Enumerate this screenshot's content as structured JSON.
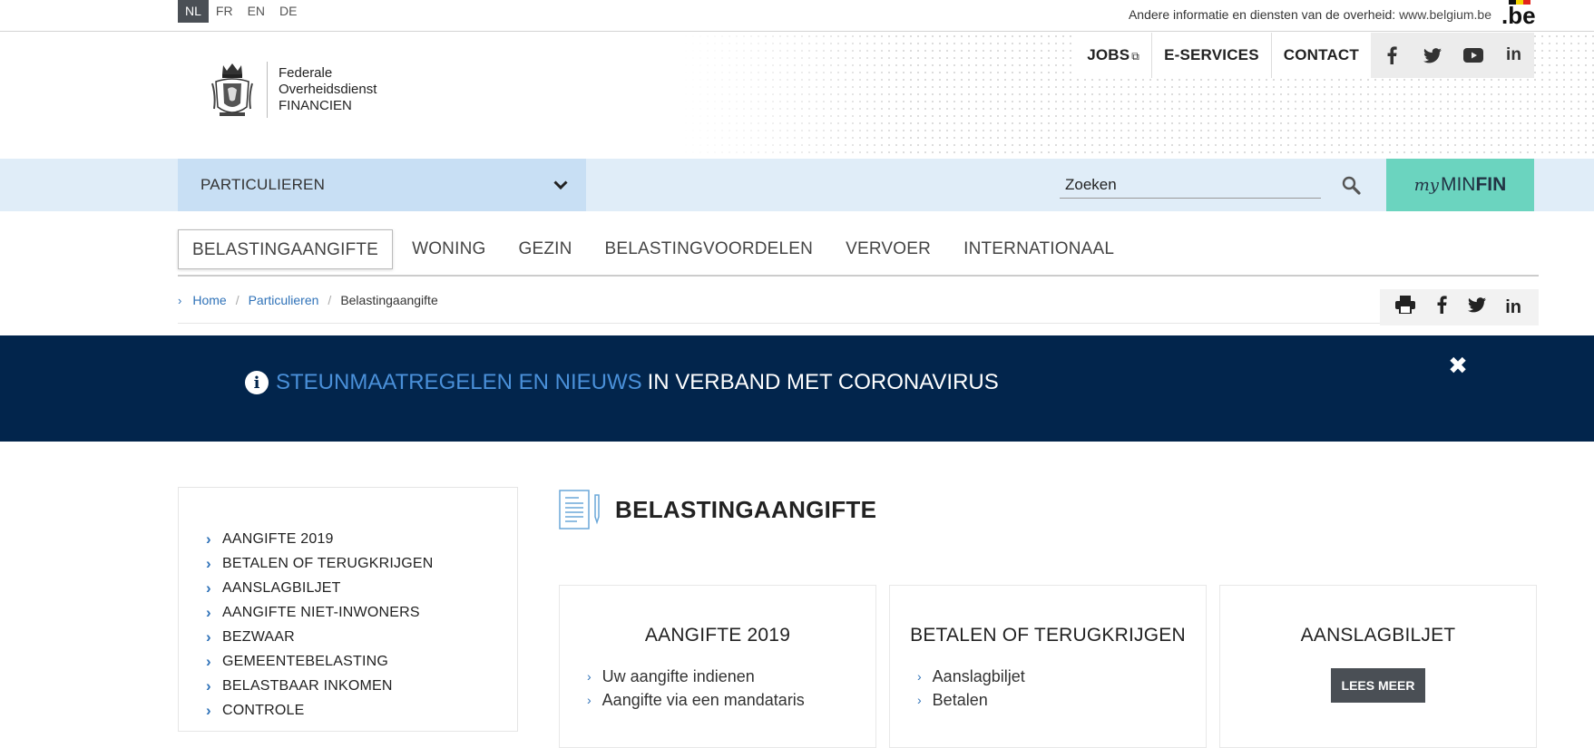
{
  "languages": [
    {
      "code": "NL",
      "active": true
    },
    {
      "code": "FR",
      "active": false
    },
    {
      "code": "EN",
      "active": false
    },
    {
      "code": "DE",
      "active": false
    }
  ],
  "gov_bar": {
    "text": "Andere informatie en diensten van de overheid:",
    "link": "www.belgium.be",
    "logo_text": ".be"
  },
  "logo": {
    "line1": "Federale",
    "line2": "Overheidsdienst",
    "line3": "FINANCIEN"
  },
  "topnav": {
    "jobs": "JOBS",
    "eservices": "E-SERVICES",
    "contact": "CONTACT"
  },
  "social": {
    "facebook": "f",
    "twitter": "twitter-icon",
    "youtube": "youtube-icon",
    "linkedin": "in"
  },
  "section_select": {
    "label": "PARTICULIEREN"
  },
  "search": {
    "placeholder": "Zoeken"
  },
  "myminfin": {
    "my": "my",
    "min": "MIN",
    "fin": "FIN"
  },
  "mainnav": {
    "items": [
      "BELASTINGAANGIFTE",
      "WONING",
      "GEZIN",
      "BELASTINGVOORDELEN",
      "VERVOER",
      "INTERNATIONAAL"
    ]
  },
  "breadcrumb": {
    "home": "Home",
    "particulieren": "Particulieren",
    "current": "Belastingaangifte"
  },
  "banner": {
    "link": "STEUNMAATREGELEN EN NIEUWS",
    "rest": "IN VERBAND MET CORONAVIRUS",
    "close": "✖"
  },
  "sidebar": {
    "items": [
      "AANGIFTE 2019",
      "BETALEN OF TERUGKRIJGEN",
      "AANSLAGBILJET",
      "AANGIFTE NIET-INWONERS",
      "BEZWAAR",
      "GEMEENTEBELASTING",
      "BELASTBAAR INKOMEN",
      "CONTROLE"
    ]
  },
  "page": {
    "title": "BELASTINGAANGIFTE"
  },
  "cards": [
    {
      "title": "AANGIFTE 2019",
      "links": [
        "Uw aangifte indienen",
        "Aangifte via een mandataris"
      ]
    },
    {
      "title": "BETALEN OF TERUGKRIJGEN",
      "links": [
        "Aanslagbiljet",
        "Betalen"
      ]
    },
    {
      "title": "AANSLAGBILJET",
      "button": "LEES MEER"
    }
  ],
  "colors": {
    "banner_bg": "#02254c",
    "accent_blue": "#2f72b8",
    "myminfin_bg": "#6bd4bf",
    "band_bg": "#e0edf8"
  }
}
